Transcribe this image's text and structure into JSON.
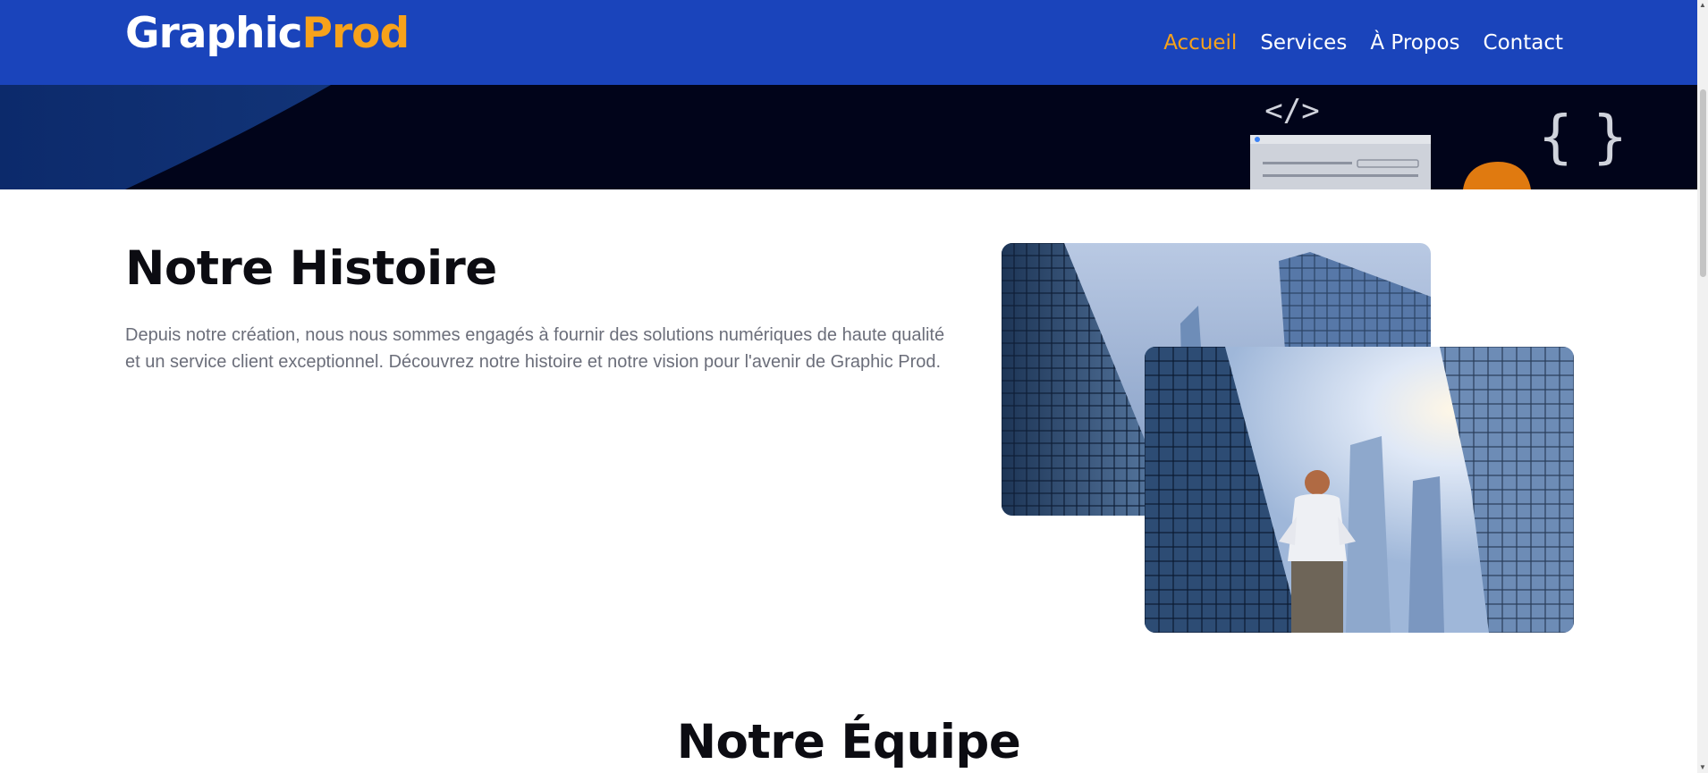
{
  "header": {
    "logo_main": "Graphic",
    "logo_accent": "Prod",
    "nav": [
      {
        "label": "Accueil",
        "active": true
      },
      {
        "label": "Services",
        "active": false
      },
      {
        "label": "À Propos",
        "active": false
      },
      {
        "label": "Contact",
        "active": false
      }
    ]
  },
  "hero": {
    "code_tag_text": "</>",
    "braces_text": "{ }"
  },
  "history": {
    "title": "Notre Histoire",
    "text": "Depuis notre création, nous nous sommes engagés à fournir des solutions numériques de haute qualité et un service client exceptionnel. Découvrez notre histoire et notre vision pour l'avenir de Graphic Prod."
  },
  "team": {
    "title": "Notre Équipe"
  },
  "colors": {
    "brand_blue": "#1a44bb",
    "accent_orange": "#f7a21b",
    "hero_dark": "#01041a",
    "text_dark": "#0c0c12",
    "text_muted": "#6b6e7a"
  },
  "icons": [
    "code-tag-icon",
    "curly-braces-icon",
    "browser-window-icon"
  ]
}
